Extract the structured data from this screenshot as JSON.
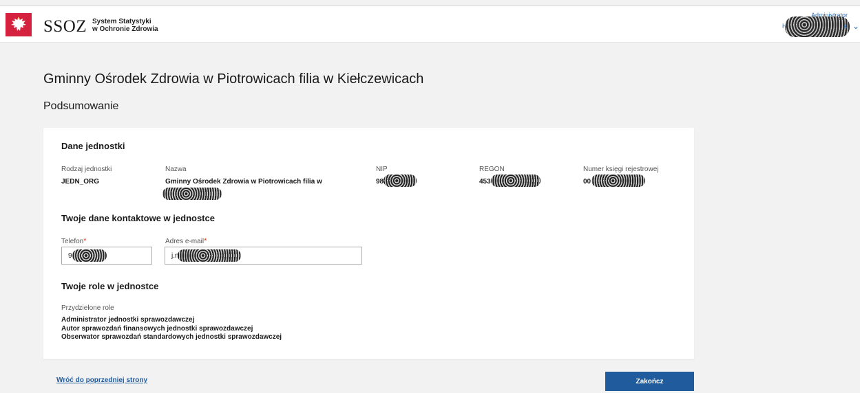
{
  "header": {
    "logo_text": "SSOZ",
    "logo_subtitle_line1": "System Statystyki",
    "logo_subtitle_line2": "w Ochronie Zdrowia",
    "emblem_icon": "polish-eagle-emblem",
    "user_role": "Administrator",
    "user_name_prefix": "H",
    "user_name_suffix": "a"
  },
  "page": {
    "title": "Gminny Ośrodek Zdrowia w Piotrowicach filia w Kiełczewicach",
    "section": "Podsumowanie"
  },
  "unit": {
    "heading": "Dane jednostki",
    "type_label": "Rodzaj jednostki",
    "type_value": "JEDN_ORG",
    "name_label": "Nazwa",
    "name_value": "Gminny Ośrodek Zdrowia w Piotrowicach filia w",
    "nip_label": "NIP",
    "nip_prefix": "98",
    "regon_label": "REGON",
    "regon_prefix": "453",
    "registry_label": "Numer księgi rejestrowej",
    "registry_prefix": "00"
  },
  "contact": {
    "heading": "Twoje dane kontaktowe w jednostce",
    "phone_label": "Telefon",
    "phone_prefix": "9",
    "email_label": "Adres e-mail",
    "email_prefix": "j.n",
    "required_mark": "*"
  },
  "roles": {
    "heading": "Twoje role w jednostce",
    "assigned_label": "Przydzielone role",
    "items": [
      "Administrator jednostki sprawozdawczej",
      "Autor sprawozdań finansowych jednostki sprawozdawczej",
      "Obserwator sprawozdań standardowych jednostki sprawozdawczej"
    ]
  },
  "actions": {
    "back_label": "Wróć do poprzedniej strony",
    "finish_label": "Zakończ"
  },
  "colors": {
    "primary": "#1f5b9d",
    "emblem_red": "#d4213d",
    "required": "#d43f1f"
  }
}
